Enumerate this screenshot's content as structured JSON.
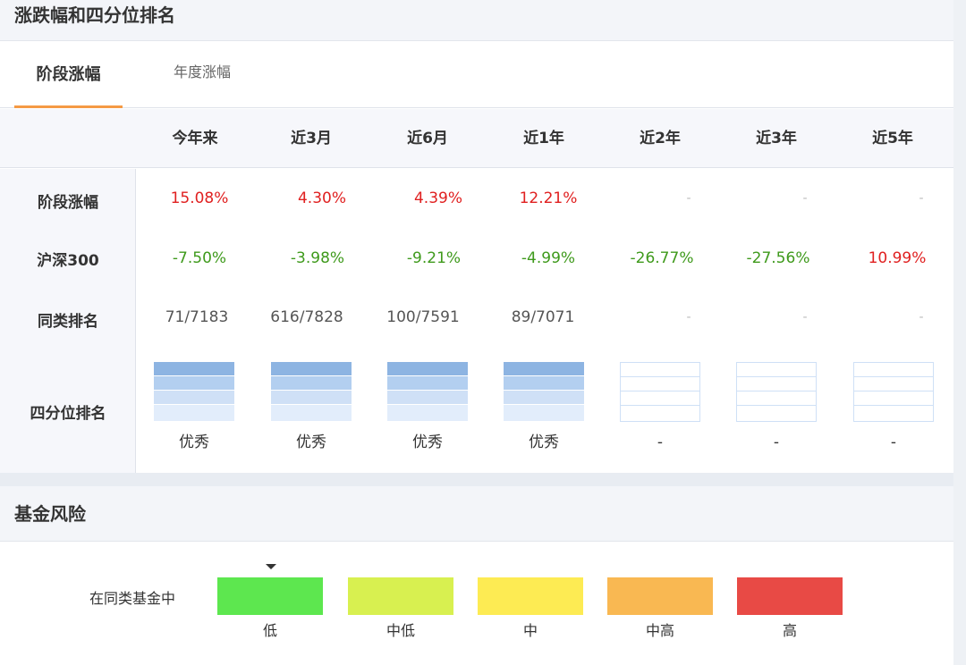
{
  "section1": {
    "title": "涨跌幅和四分位排名",
    "tabs": [
      {
        "label": "阶段涨幅",
        "active": true
      },
      {
        "label": "年度涨幅",
        "active": false
      }
    ],
    "columns": [
      "今年来",
      "近3月",
      "近6月",
      "近1年",
      "近2年",
      "近3年",
      "近5年"
    ],
    "rows": {
      "stage": {
        "label": "阶段涨幅",
        "values": [
          "15.08%",
          "4.30%",
          "4.39%",
          "12.21%",
          "-",
          "-",
          "-"
        ]
      },
      "hs300": {
        "label": "沪深300",
        "values": [
          "-7.50%",
          "-3.98%",
          "-9.21%",
          "-4.99%",
          "-26.77%",
          "-27.56%",
          "10.99%"
        ]
      },
      "rank": {
        "label": "同类排名",
        "values": [
          "71/7183",
          "616/7828",
          "100/7591",
          "89/7071",
          "-",
          "-",
          "-"
        ]
      },
      "quartile": {
        "label": "四分位排名",
        "values": [
          "优秀",
          "优秀",
          "优秀",
          "优秀",
          "-",
          "-",
          "-"
        ]
      }
    },
    "colors": {
      "positive": "#e02020",
      "negative": "#3f9a1c",
      "tab_accent": "#f59a44"
    }
  },
  "section2": {
    "title": "基金风险",
    "label": "在同类基金中",
    "current_level": "低",
    "levels": [
      {
        "name": "低",
        "color": "#5de74f"
      },
      {
        "name": "中低",
        "color": "#d8f050"
      },
      {
        "name": "中",
        "color": "#fdeb53"
      },
      {
        "name": "中高",
        "color": "#f9b852"
      },
      {
        "name": "高",
        "color": "#e84a45"
      }
    ]
  }
}
